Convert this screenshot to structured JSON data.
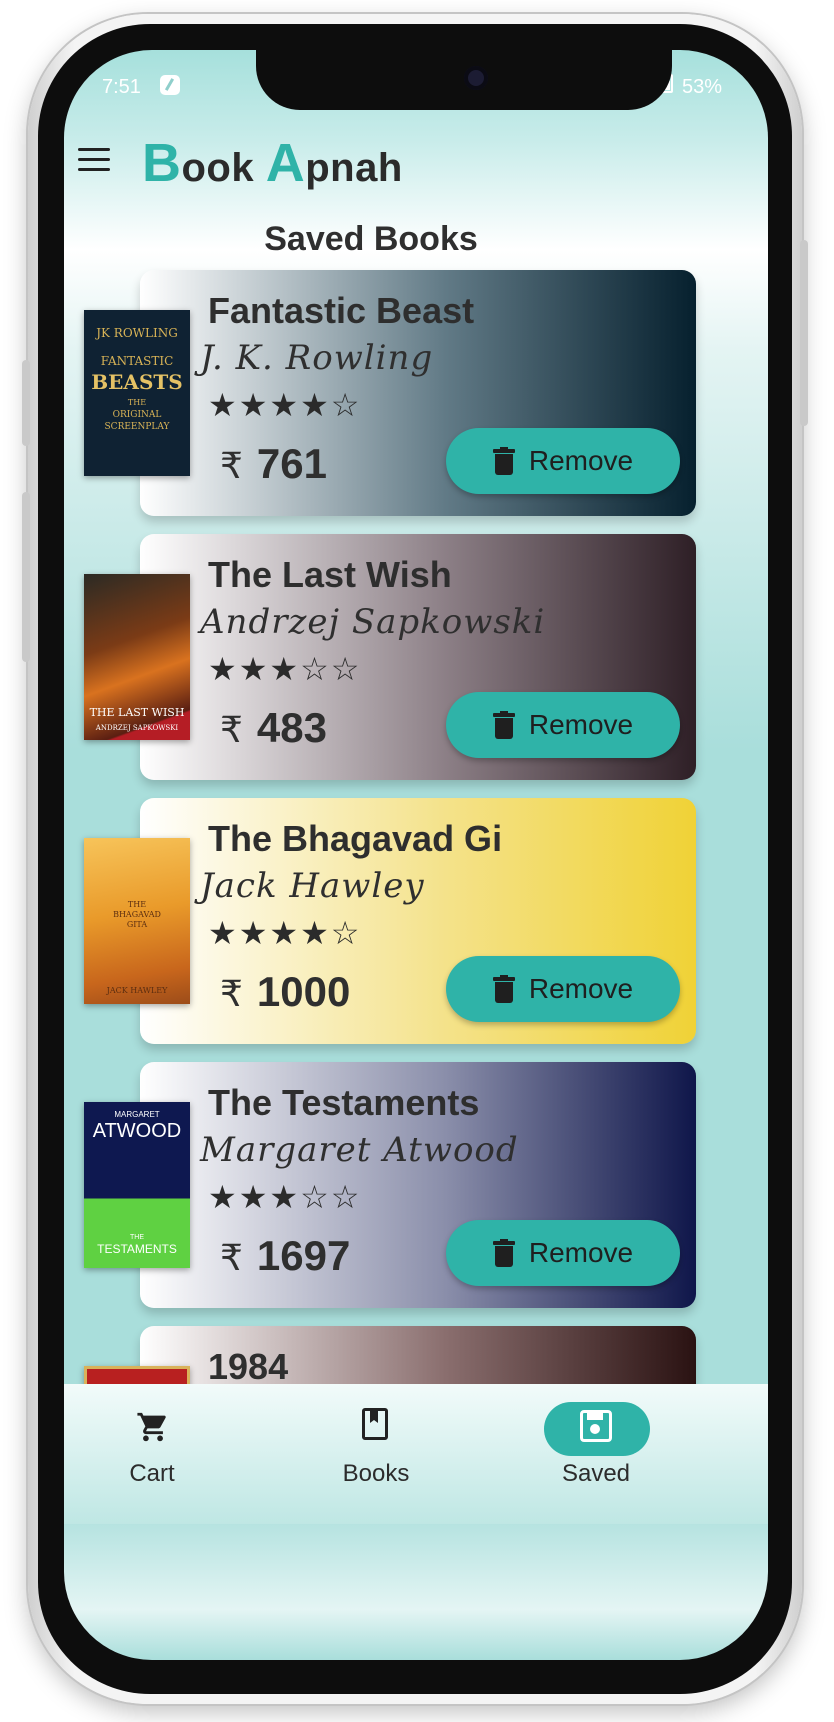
{
  "status_bar": {
    "time": "7:51",
    "battery": "53%"
  },
  "app": {
    "title_first_initial": "B",
    "title_first_rest": "ook",
    "title_second_initial": "A",
    "title_second_rest": "pnah"
  },
  "page": {
    "title": "Saved Books"
  },
  "currency_symbol": "₹",
  "remove_label": "Remove",
  "books": [
    {
      "title": "Fantastic Beast",
      "author": "J. K. Rowling",
      "rating": 4,
      "stars": "★★★★☆",
      "price": "761",
      "card_gradient": [
        "#ffffff",
        "#617a86",
        "#06202e"
      ],
      "cover": {
        "lines": [
          "JK ROWLING",
          "FANTASTIC",
          "BEASTS",
          "THE",
          "ORIGINAL",
          "SCREENPLAY"
        ]
      }
    },
    {
      "title": "The Last Wish",
      "author": "Andrzej Sapkowski",
      "rating": 3,
      "stars": "★★★☆☆",
      "price": "483",
      "card_gradient": [
        "#ffffff",
        "#8c7f86",
        "#2e1f26"
      ],
      "cover": {
        "lines": [
          "THE LAST WISH",
          "ANDRZEJ  SAPKOWSKI"
        ]
      }
    },
    {
      "title": "The Bhagavad Gi",
      "author": "Jack Hawley",
      "rating": 4,
      "stars": "★★★★☆",
      "price": "1000",
      "card_gradient": [
        "#ffffff",
        "#f4e28a",
        "#f0d236"
      ],
      "cover": {
        "lines": [
          "THE",
          "BHAGAVAD",
          "GITA",
          "JACK HAWLEY"
        ]
      }
    },
    {
      "title": "The Testaments",
      "author": "Margaret Atwood",
      "rating": 3,
      "stars": "★★★☆☆",
      "price": "1697",
      "card_gradient": [
        "#ffffff",
        "#8a8eaa",
        "#0f164a"
      ],
      "cover": {
        "lines": [
          "MARGARET",
          "ATWOOD",
          "THE",
          "TESTAMENTS"
        ]
      }
    },
    {
      "title": "1984",
      "author": "",
      "rating": 0,
      "stars": "",
      "price": "",
      "card_gradient": [
        "#ffffff",
        "#8a6e6e",
        "#2a1212"
      ],
      "cover": {
        "lines": []
      }
    }
  ],
  "bottom_nav": {
    "items": [
      {
        "label": "Cart",
        "icon": "cart-icon",
        "active": false
      },
      {
        "label": "Books",
        "icon": "book-icon",
        "active": false
      },
      {
        "label": "Saved",
        "icon": "save-icon",
        "active": true
      }
    ]
  },
  "colors": {
    "accent": "#2fb3a8",
    "teal_bg": "#a9dedb",
    "text_dark": "#2e2e2e"
  }
}
